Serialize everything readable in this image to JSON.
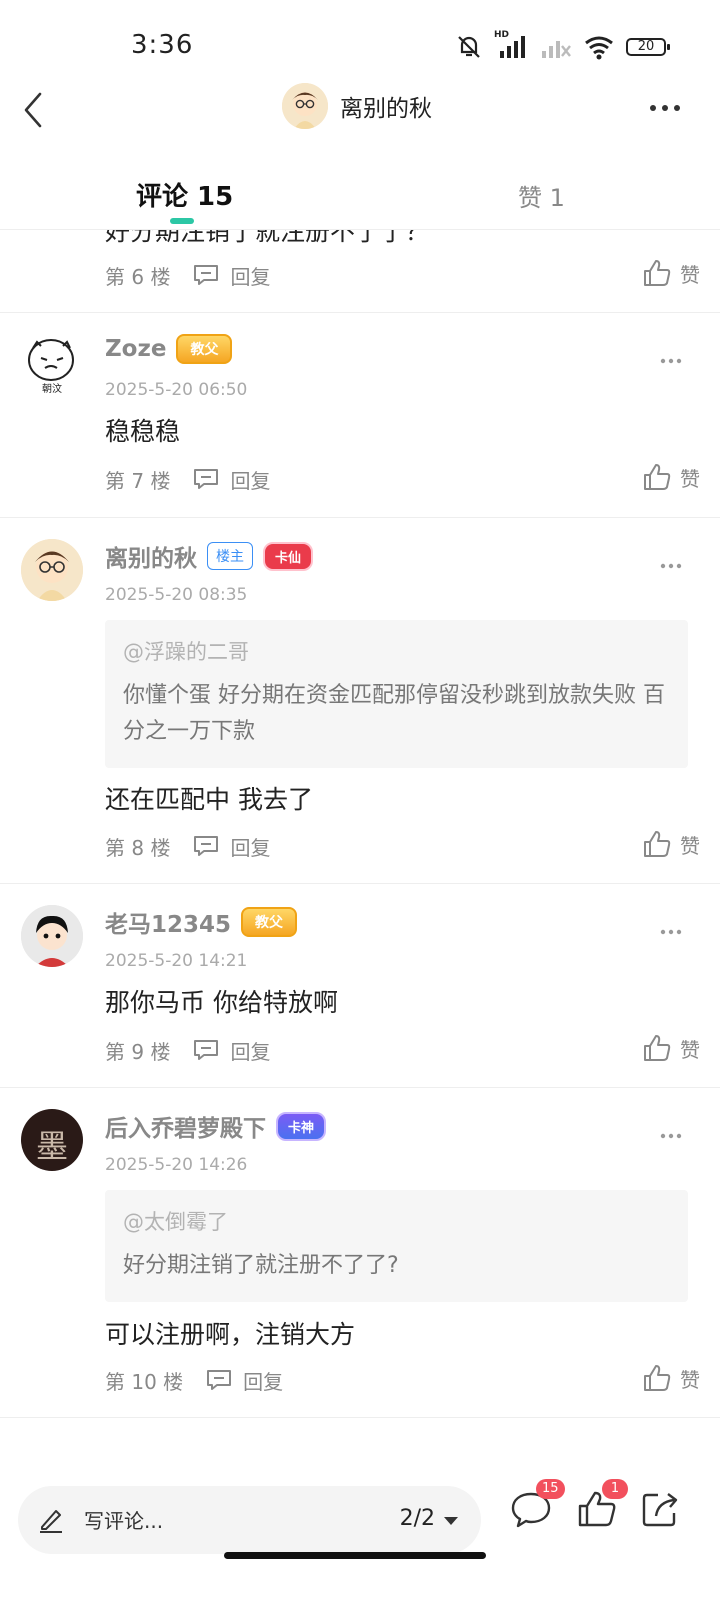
{
  "status_bar": {
    "time": "3:36",
    "battery": "20",
    "network_label": "HD"
  },
  "nav": {
    "title": "离别的秋"
  },
  "tabs": {
    "comments_label": "评论 15",
    "likes_label": "赞 1"
  },
  "partial_comment": {
    "text": "好分期注销了就注册不了了？",
    "floor": "第 6 楼",
    "reply_label": "回复",
    "like_label": "赞"
  },
  "comments": [
    {
      "name": "Zoze",
      "badges": [
        "教父"
      ],
      "avatar_text": "朝汶",
      "time": "2025-5-20 06:50",
      "text": "稳稳稳",
      "floor": "第 7 楼",
      "reply_label": "回复",
      "like_label": "赞"
    },
    {
      "name": "离别的秋",
      "badges": [
        "楼主",
        "卡仙"
      ],
      "time": "2025-5-20 08:35",
      "quote_user": "@浮躁的二哥",
      "quote_text": "你懂个蛋 好分期在资金匹配那停留没秒跳到放款失败 百分之一万下款",
      "text": "还在匹配中  我去了",
      "floor": "第 8 楼",
      "reply_label": "回复",
      "like_label": "赞"
    },
    {
      "name": "老马12345",
      "badges": [
        "教父"
      ],
      "time": "2025-5-20 14:21",
      "text": "那你马币 你给特放啊",
      "floor": "第 9 楼",
      "reply_label": "回复",
      "like_label": "赞"
    },
    {
      "name": "后入乔碧萝殿下",
      "badges": [
        "卡神"
      ],
      "avatar_text": "墨",
      "time": "2025-5-20 14:26",
      "quote_user": "@太倒霉了",
      "quote_text": "好分期注销了就注册不了了?",
      "text": "可以注册啊，注销大方",
      "floor": "第 10 楼",
      "reply_label": "回复",
      "like_label": "赞"
    }
  ],
  "bottom_bar": {
    "write_placeholder": "写评论...",
    "page_indicator": "2/2",
    "comment_count": "15",
    "like_count": "1"
  },
  "colors": {
    "accent": "#2cc7a5",
    "badge_red": "#f2505d",
    "owner_blue": "#3b8ff5"
  }
}
